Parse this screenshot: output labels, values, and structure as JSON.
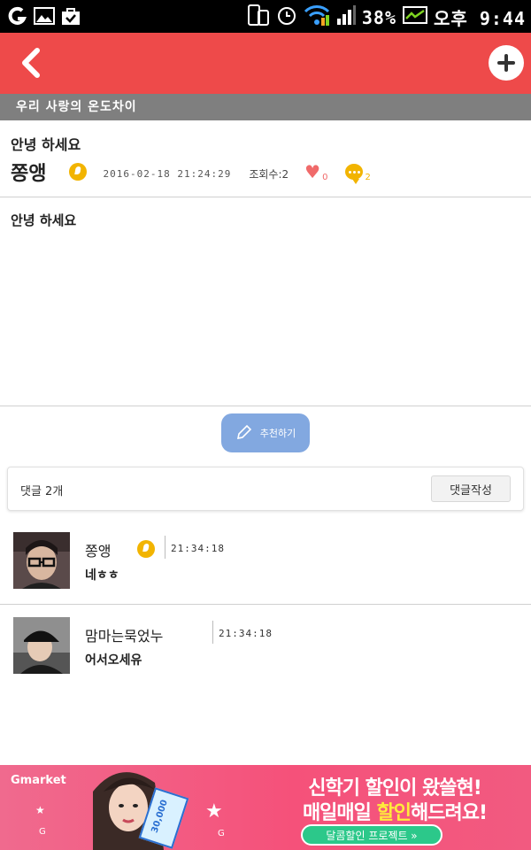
{
  "status_bar": {
    "battery": "38%",
    "time": "오후 9:44"
  },
  "header": {
    "back_icon": "chevron-left-icon",
    "add_icon": "plus-icon"
  },
  "category": "우리 사랑의 온도차이",
  "post": {
    "title": "안녕 하세요",
    "author": "쫑앵",
    "date": "2016-02-18 21:24:29",
    "views": "조회수:2",
    "likes": "0",
    "comments": "2",
    "body": "안녕 하세요"
  },
  "recommend": {
    "label": "추천하기"
  },
  "comments_section": {
    "count_label": "댓글 2개",
    "write_label": "댓글작성"
  },
  "comments": [
    {
      "author": "쫑앵",
      "time": "21:34:18",
      "text": "네ㅎㅎ"
    },
    {
      "author": "맘마는묵었누",
      "time": "21:34:18",
      "text": "어서오세유"
    }
  ],
  "ad": {
    "brand": "Gmarket",
    "line1": "신학기 할인이 왔쓸현!",
    "line2_a": "매일매일 ",
    "line2_hl": "할인",
    "line2_b": "해드려요!",
    "cta": "달콤할인 프로젝트 »",
    "coupon": "30,000"
  },
  "colors": {
    "appbar": "#ee4a4a",
    "category": "#7f7f7f",
    "recommend": "#82a8e0",
    "badge": "#f2b400",
    "heart": "#f06a6a"
  }
}
